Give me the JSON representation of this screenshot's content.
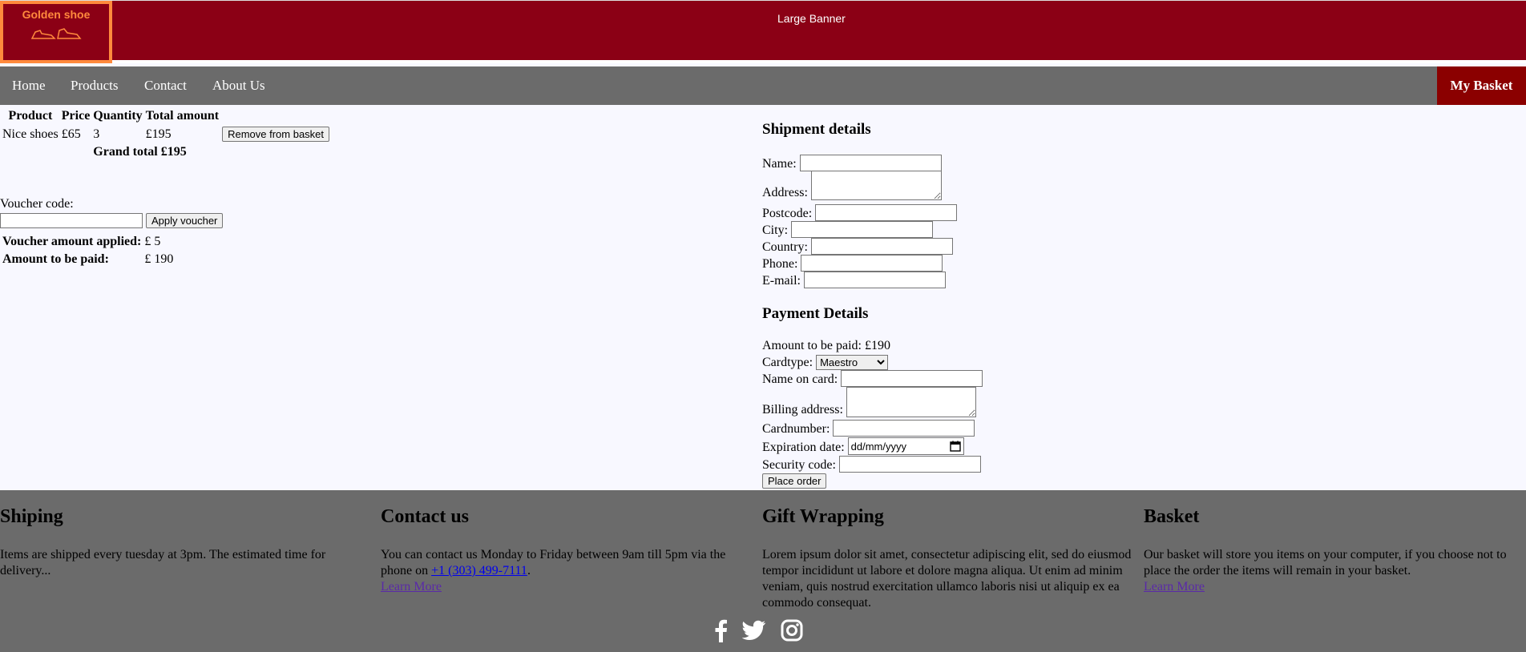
{
  "header": {
    "logo_text": "Golden shoe",
    "banner_text": "Large Banner"
  },
  "nav": {
    "items": [
      "Home",
      "Products",
      "Contact",
      "About Us"
    ],
    "basket_label": "My Basket"
  },
  "basket": {
    "headers": [
      "Product",
      "Price",
      "Quantity",
      "Total amount"
    ],
    "rows": [
      {
        "product": "Nice shoes",
        "price": "£65",
        "quantity": "3",
        "total": "£195",
        "action": "Remove from basket"
      }
    ],
    "grand_total_label": "Grand total £195"
  },
  "voucher": {
    "label": "Voucher code:",
    "input_value": "",
    "button": "Apply voucher",
    "applied_label": "Voucher amount applied:",
    "applied_value": "£ 5",
    "to_pay_label": "Amount to be paid:",
    "to_pay_value": "£ 190"
  },
  "shipment": {
    "title": "Shipment details",
    "fields": {
      "name": "Name:",
      "address": "Address:",
      "postcode": "Postcode:",
      "city": "City:",
      "country": "Country:",
      "phone": "Phone:",
      "email": "E-mail:"
    }
  },
  "payment": {
    "title": "Payment Details",
    "amount_line": "Amount to be paid: £190",
    "cardtype_label": "Cardtype:",
    "cardtype_value": "Maestro",
    "name_on_card": "Name on card:",
    "billing_address": "Billing address:",
    "cardnumber": "Cardnumber:",
    "expiration": "Expiration date:",
    "expiration_placeholder": "dd/mm/yyyy",
    "security_code": "Security code:",
    "submit": "Place order"
  },
  "footer": {
    "shipping": {
      "title": "Shiping",
      "text": "Items are shipped every tuesday at 3pm. The estimated time for delivery..."
    },
    "contact": {
      "title": "Contact us",
      "text_before": "You can contact us Monday to Friday between 9am till 5pm via the phone on ",
      "phone": "+1 (303) 499-7111",
      "text_after": ".",
      "link": "Learn More"
    },
    "gift": {
      "title": "Gift Wrapping",
      "text": "Lorem ipsum dolor sit amet, consectetur adipiscing elit, sed do eiusmod tempor incididunt ut labore et dolore magna aliqua. Ut enim ad minim veniam, quis nostrud exercitation ullamco laboris nisi ut aliquip ex ea commodo consequat."
    },
    "basket": {
      "title": "Basket",
      "text": "Our basket will store you items on your computer, if you choose not to place the order the items will remain in your basket.",
      "link": "Learn More"
    },
    "social_icons": [
      "facebook-icon",
      "twitter-icon",
      "instagram-icon"
    ]
  }
}
